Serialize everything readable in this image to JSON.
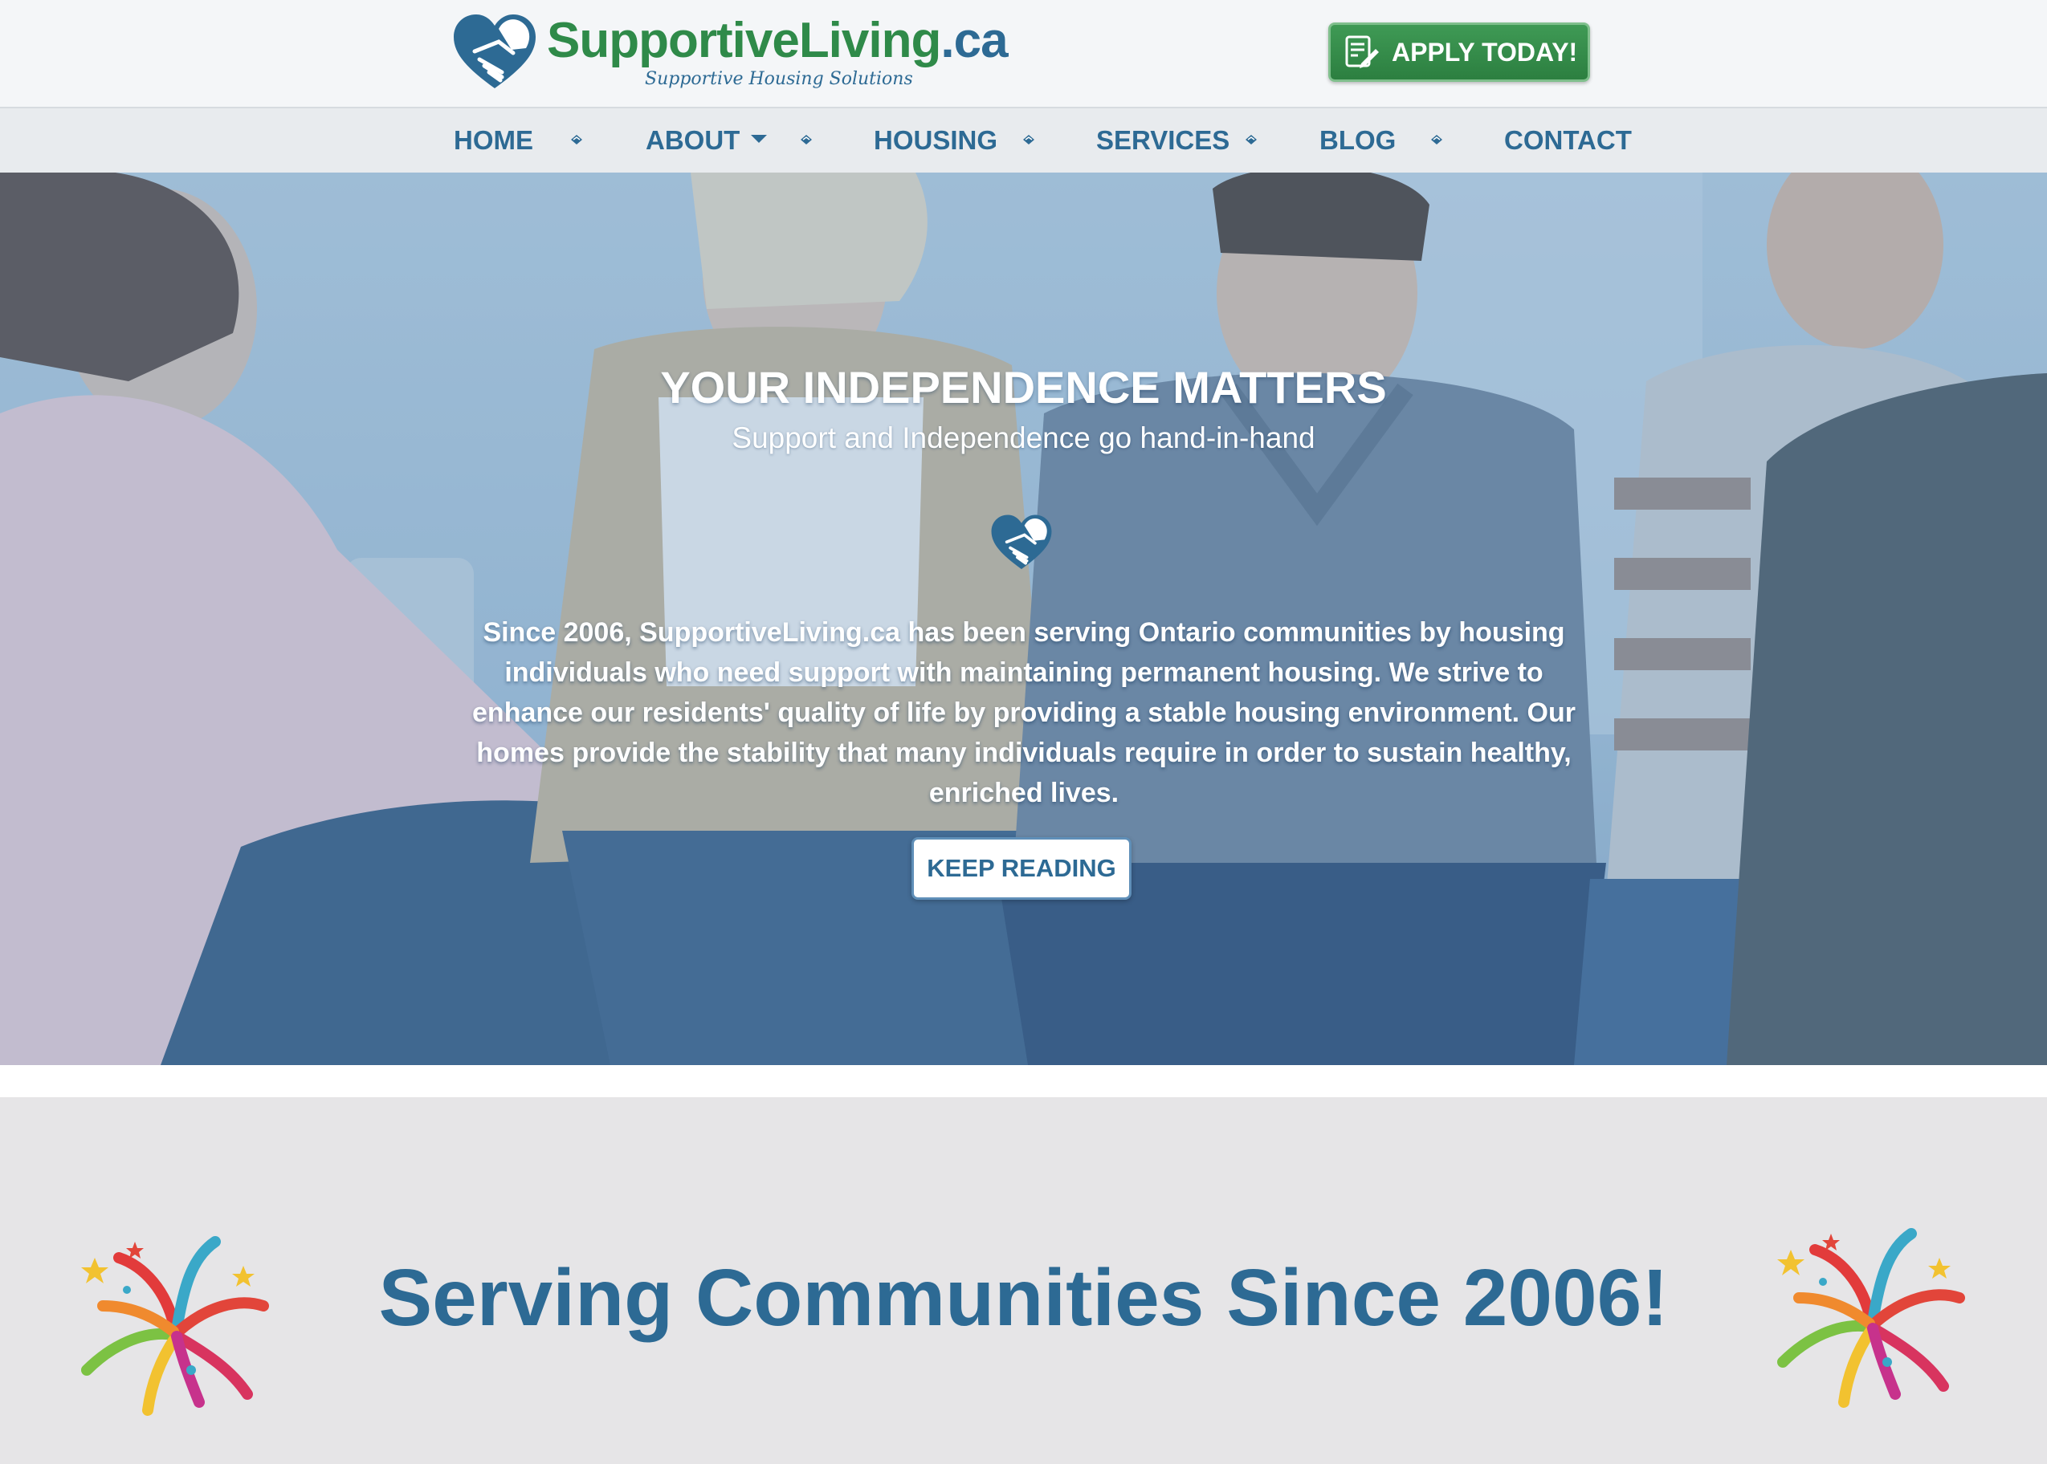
{
  "header": {
    "logo": {
      "name_part1": "Supportive",
      "name_part2": "Living",
      "name_part3": ".ca",
      "tagline": "Supportive Housing Solutions",
      "icon": "heart-handshake-icon"
    },
    "apply_button": {
      "label": "APPLY TODAY!",
      "icon": "application-form-icon"
    }
  },
  "nav": {
    "items": [
      {
        "label": "HOME"
      },
      {
        "label": "ABOUT",
        "has_dropdown": true
      },
      {
        "label": "HOUSING"
      },
      {
        "label": "SERVICES"
      },
      {
        "label": "BLOG"
      },
      {
        "label": "CONTACT"
      }
    ],
    "separator_icon": "diamond-separator-icon"
  },
  "hero": {
    "title": "YOUR INDEPENDENCE MATTERS",
    "subtitle": "Support and Independence go hand-in-hand",
    "body": "Since 2006, SupportiveLiving.ca has been serving Ontario communities by housing individuals who need support with maintaining permanent housing. We strive to enhance our residents' quality of life by providing a stable housing environment. Our homes provide the stability that many individuals require in order to sustain healthy, enriched lives.",
    "button_label": "KEEP READING"
  },
  "banner": {
    "title": "Serving Communities Since 2006!",
    "left_icon": "fireworks-icon",
    "right_icon": "fireworks-icon"
  },
  "colors": {
    "brand_blue": "#2d6a94",
    "brand_green": "#2f8a49",
    "banner_bg": "#e6e5e7"
  }
}
